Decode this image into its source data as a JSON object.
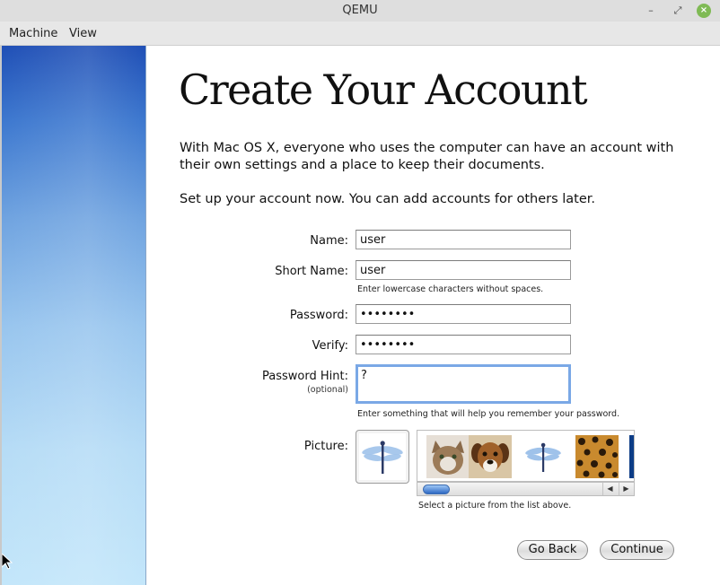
{
  "window": {
    "title": "QEMU",
    "controls": {
      "minimize": "–",
      "maximize": "⤢",
      "close": "×"
    }
  },
  "menubar": {
    "items": [
      "Machine",
      "View"
    ]
  },
  "setup": {
    "heading": "Create Your Account",
    "intro": "With Mac OS X, everyone who uses the computer can have an account with their own settings and a place to keep their documents.",
    "instruction": "Set up your account now. You can add accounts for others later.",
    "form": {
      "name_label": "Name:",
      "name_value": "user",
      "short_name_label": "Short Name:",
      "short_name_value": "user",
      "short_name_note": "Enter lowercase characters without spaces.",
      "password_label": "Password:",
      "password_value": "••••••••",
      "verify_label": "Verify:",
      "verify_value": "••••••••",
      "hint_label": "Password Hint:",
      "hint_sublabel": "(optional)",
      "hint_value": "?",
      "hint_note": "Enter something that will help you remember your password.",
      "picture_label": "Picture:",
      "picture_selected": "dragonfly",
      "picture_options": [
        "cat",
        "puppy",
        "dragonfly",
        "leopard",
        "blue"
      ],
      "picture_note": "Select a picture from the list above."
    },
    "buttons": {
      "back": "Go Back",
      "continue": "Continue"
    },
    "colors": {
      "accent": "#7aa8e6",
      "sidebar_top": "#1f4fb6",
      "sidebar_bottom": "#c3e6fa"
    }
  }
}
